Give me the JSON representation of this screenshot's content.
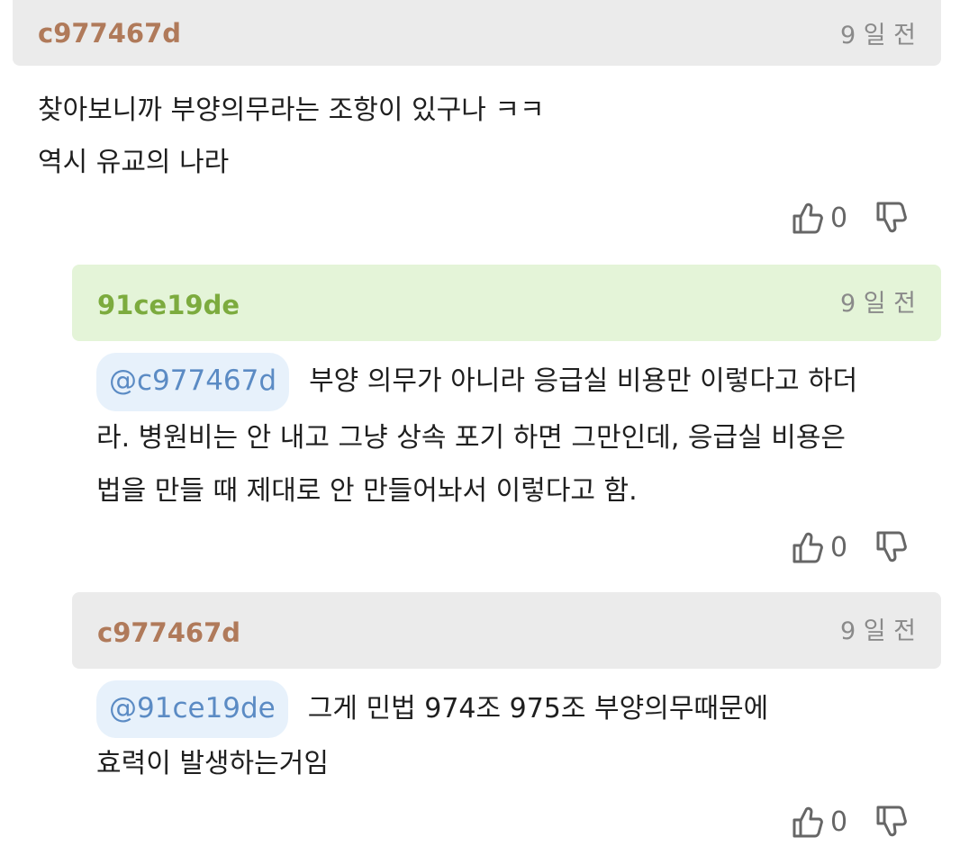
{
  "comments": [
    {
      "author": "c977467d",
      "time": "9 일 전",
      "mention": "",
      "lines": [
        "찾아보니까 부양의무라는 조항이 있구나 ㅋㅋ",
        "역시 유교의 나라"
      ],
      "likes": "0"
    },
    {
      "author": "91ce19de",
      "time": "9 일 전",
      "mention": "@c977467d",
      "lines": [
        "부양 의무가 아니라 응급실 비용만 이렇다고 하더",
        "라. 병원비는 안 내고 그냥 상속 포기 하면 그만인데, 응급실 비용은",
        "법을 만들 때 제대로 안 만들어놔서 이렇다고 함."
      ],
      "likes": "0"
    },
    {
      "author": "c977467d",
      "time": "9 일 전",
      "mention": "@91ce19de",
      "lines": [
        "그게 민법 974조 975조 부양의무때문에",
        "효력이 발생하는거임"
      ],
      "likes": "0"
    }
  ],
  "colors": {
    "author_brown": "#b07a5a",
    "author_green": "#7cab3e",
    "header_gray": "#ebebeb",
    "header_green": "#e4f4d8",
    "mention_bg": "#e7f1fb",
    "mention_text": "#5b8bc4"
  },
  "icons": {
    "like": "thumbs-up-icon",
    "dislike": "thumbs-down-icon"
  }
}
